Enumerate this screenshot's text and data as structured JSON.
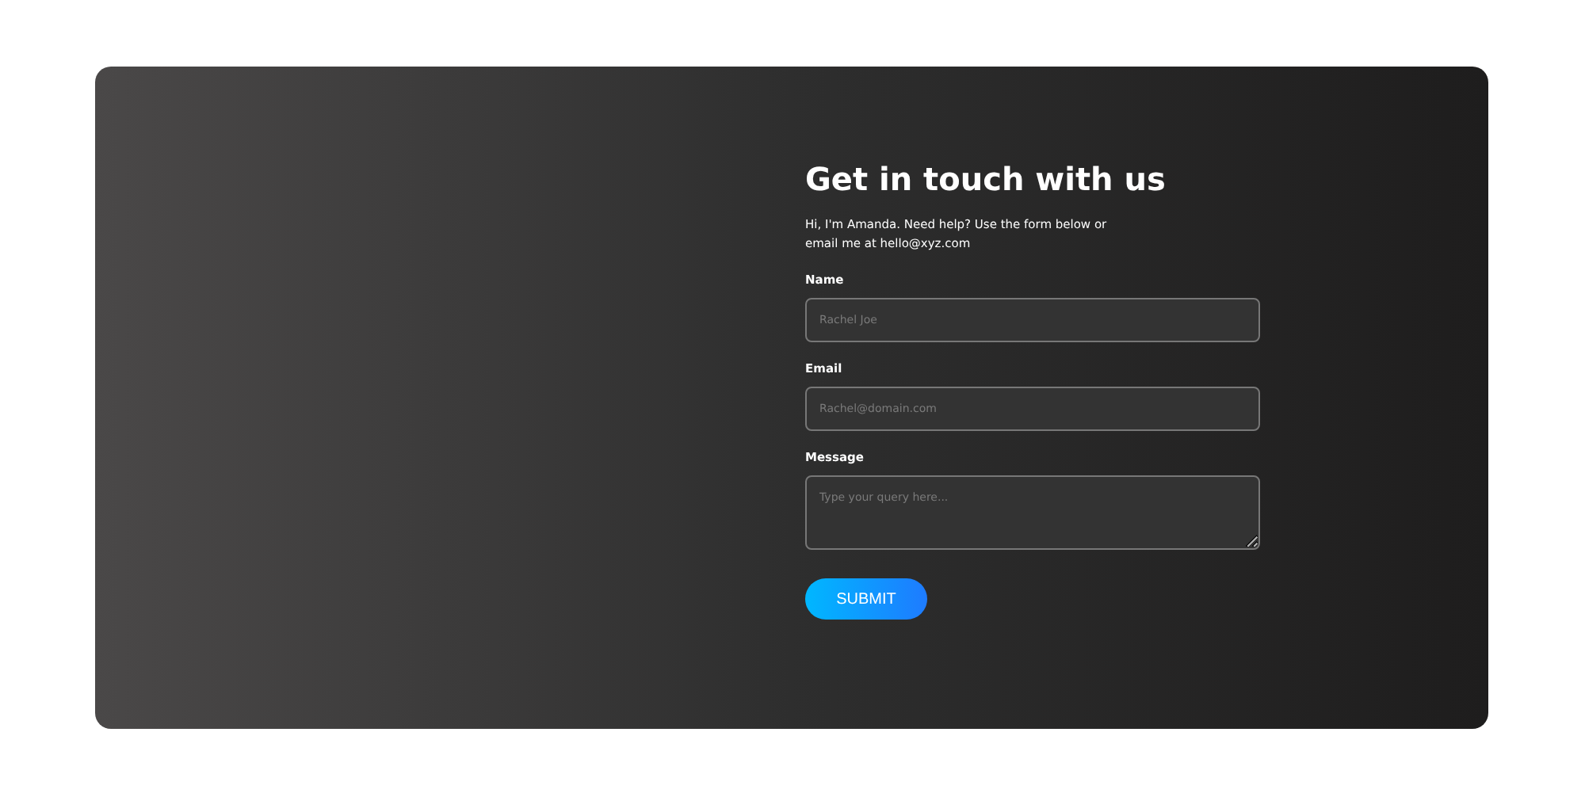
{
  "title": "Get in touch with us",
  "intro": "Hi, I'm Amanda. Need help? Use the form below or email me at hello@xyz.com",
  "fields": [
    {
      "kind": "input",
      "label": "Name",
      "placeholder": "Rachel Joe"
    },
    {
      "kind": "input",
      "label": "Email",
      "placeholder": "Rachel@domain.com"
    },
    {
      "kind": "textarea",
      "label": "Message",
      "placeholder": "Type your query here..."
    }
  ],
  "submit": "SUBMIT"
}
